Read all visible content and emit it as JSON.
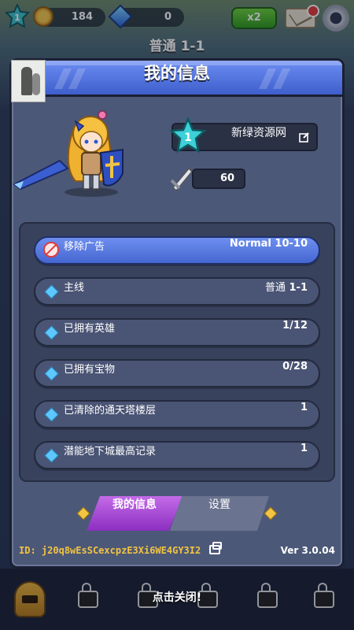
{
  "topbar": {
    "level": "1",
    "coins": "184",
    "gems": "0",
    "multiplier": "x2"
  },
  "stage_title": "普通 1-1",
  "panel": {
    "title": "我的信息",
    "player": {
      "level": "1",
      "name": "新绿资源网",
      "power": "60"
    },
    "rows": [
      {
        "icon": "no-ads-icon",
        "label": "移除广告",
        "value": "Normal 10-10"
      },
      {
        "icon": "diamond-icon",
        "label": "主线",
        "value_prefix": "普通",
        "value": "1-1"
      },
      {
        "icon": "diamond-icon",
        "label": "已拥有英雄",
        "value": "1/12"
      },
      {
        "icon": "diamond-icon",
        "label": "已拥有宝物",
        "value": "0/28"
      },
      {
        "icon": "diamond-icon",
        "label": "已清除的通天塔楼层",
        "value": "1"
      },
      {
        "icon": "diamond-icon",
        "label": "潜能地下城最高记录",
        "value": "1"
      }
    ],
    "tabs": {
      "info": "我的信息",
      "settings": "设置"
    },
    "footer": {
      "id_label": "ID:",
      "id_value": "j20q8wEsSCexcpzE3Xi6WE4GY3I2",
      "version": "Ver 3.0.04"
    }
  },
  "close_hint": "点击关闭!",
  "colors": {
    "panel": "#4c5877",
    "header": "#4e72e0",
    "active_tab": "#a64ad6",
    "accent_gold": "#f2c443"
  }
}
